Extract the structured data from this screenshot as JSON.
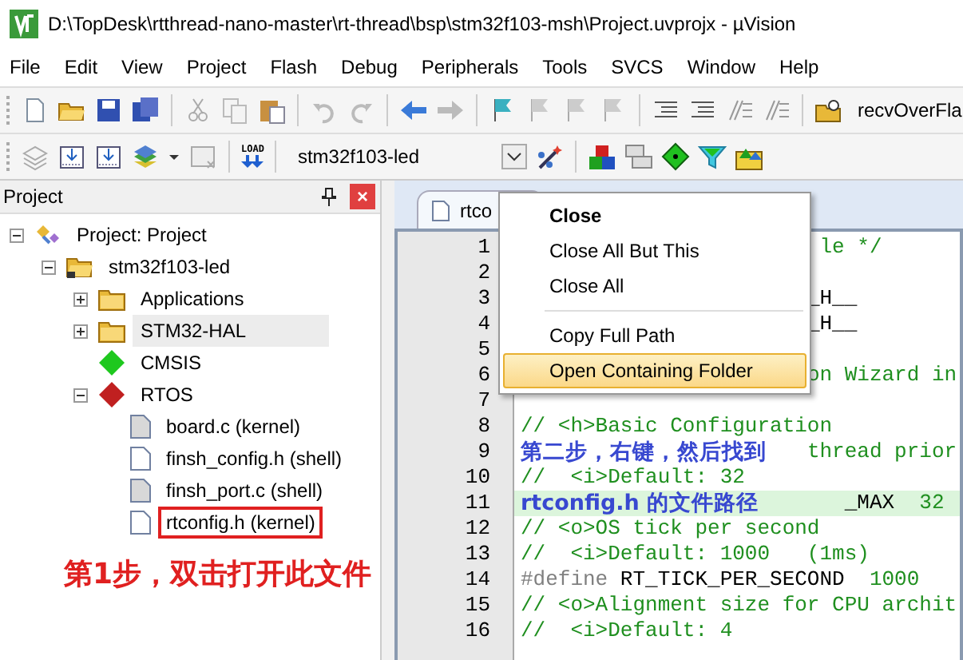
{
  "window": {
    "title": "D:\\TopDesk\\rtthread-nano-master\\rt-thread\\bsp\\stm32f103-msh\\Project.uvprojx - µVision"
  },
  "menu_bar": [
    "File",
    "Edit",
    "View",
    "Project",
    "Flash",
    "Debug",
    "Peripherals",
    "Tools",
    "SVCS",
    "Window",
    "Help"
  ],
  "toolbar": {
    "find_field": "recvOverFla",
    "load_label": "LOAD",
    "target_select": "stm32f103-led"
  },
  "project_panel": {
    "title": "Project",
    "close": "×",
    "tree": [
      {
        "label": "Project: Project",
        "kind": "project",
        "expanded": true,
        "selected": false,
        "children": [
          {
            "label": "stm32f103-led",
            "kind": "target",
            "expanded": true,
            "selected": false,
            "children": [
              {
                "label": "Applications",
                "kind": "folder",
                "expanded": false,
                "selected": false
              },
              {
                "label": "STM32-HAL",
                "kind": "folder",
                "expanded": false,
                "selected": true
              },
              {
                "label": "CMSIS",
                "kind": "component",
                "color": "#1ec81e",
                "selected": false
              },
              {
                "label": "RTOS",
                "kind": "component",
                "color": "#c02020",
                "expanded": true,
                "selected": false,
                "children": [
                  {
                    "label": "board.c (kernel)",
                    "kind": "file",
                    "shaded": true,
                    "selected": false
                  },
                  {
                    "label": "finsh_config.h (shell)",
                    "kind": "file",
                    "shaded": false,
                    "selected": false
                  },
                  {
                    "label": "finsh_port.c (shell)",
                    "kind": "file",
                    "shaded": true,
                    "selected": false
                  },
                  {
                    "label": "rtconfig.h (kernel)",
                    "kind": "file",
                    "shaded": false,
                    "selected": false,
                    "boxed": true
                  }
                ]
              }
            ]
          }
        ]
      }
    ]
  },
  "editor": {
    "tab": "rtco",
    "lines": [
      {
        "number": "1",
        "segments": [
          {
            "kind": "comment",
            "text": "                        le */"
          }
        ]
      },
      {
        "number": "2"
      },
      {
        "number": "3",
        "segments": [
          {
            "kind": "plain",
            "text": "                       _H__"
          }
        ]
      },
      {
        "number": "4",
        "segments": [
          {
            "kind": "plain",
            "text": "                       _H__"
          }
        ]
      },
      {
        "number": "5"
      },
      {
        "number": "6",
        "segments": [
          {
            "kind": "comment",
            "text": "                       on Wizard in"
          }
        ]
      },
      {
        "number": "7"
      },
      {
        "number": "8",
        "segments": [
          {
            "kind": "comment",
            "text": "// <h>Basic Configuration"
          }
        ]
      },
      {
        "number": "9",
        "segments": [
          {
            "kind": "comment",
            "text": "                       thread prior"
          }
        ]
      },
      {
        "number": "10",
        "segments": [
          {
            "kind": "comment",
            "text": "//  <i>Default: 32"
          }
        ]
      },
      {
        "number": "11",
        "highlighted": true,
        "segments": [
          {
            "kind": "plain",
            "text": "                          _MAX  "
          },
          {
            "kind": "number",
            "text": "32"
          }
        ]
      },
      {
        "number": "12",
        "segments": [
          {
            "kind": "comment",
            "text": "// <o>OS tick per second"
          }
        ]
      },
      {
        "number": "13",
        "segments": [
          {
            "kind": "comment",
            "text": "//  <i>Default: 1000   (1ms)"
          }
        ]
      },
      {
        "number": "14",
        "segments": [
          {
            "kind": "preproc",
            "text": "#define"
          },
          {
            "kind": "plain",
            "text": " RT_TICK_PER_SECOND  "
          },
          {
            "kind": "number",
            "text": "1000"
          }
        ]
      },
      {
        "number": "15",
        "segments": [
          {
            "kind": "comment",
            "text": "// <o>Alignment size for CPU archit"
          }
        ]
      },
      {
        "number": "16",
        "segments": [
          {
            "kind": "comment",
            "text": "//  <i>Default: 4"
          }
        ]
      }
    ]
  },
  "context_menu": [
    {
      "label": "Close",
      "default": true,
      "separator_before": false,
      "selected": false
    },
    {
      "label": "Close All But This",
      "default": false,
      "separator_before": false,
      "selected": false
    },
    {
      "label": "Close All",
      "default": false,
      "separator_before": false,
      "selected": false
    },
    {
      "label": "Copy Full Path",
      "default": false,
      "separator_before": true,
      "selected": false
    },
    {
      "label": "Open Containing Folder",
      "default": false,
      "separator_before": false,
      "selected": true
    }
  ],
  "annotations": [
    {
      "kind": "step-one",
      "text": "第1步，双击打开此文件"
    },
    {
      "kind": "step-two",
      "text": "第二步，右键，然后找到"
    },
    {
      "kind": "step-two",
      "text": "rtconfig.h 的文件路径"
    }
  ]
}
